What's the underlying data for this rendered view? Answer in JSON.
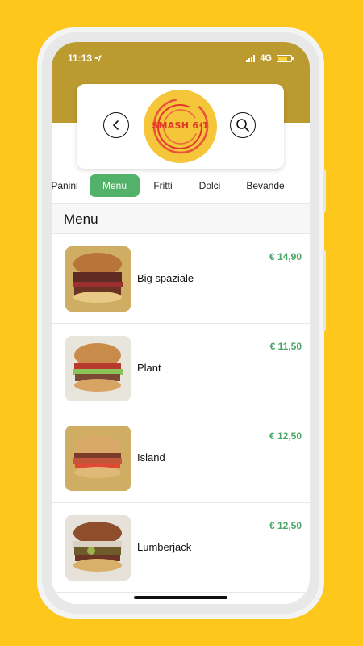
{
  "status_bar": {
    "time": "11:13",
    "network": "4G"
  },
  "header": {
    "logo_text": "SMASH 6·1",
    "back_icon": "chevron-left-icon",
    "search_icon": "search-icon"
  },
  "categories": [
    {
      "label": "Panini",
      "active": false
    },
    {
      "label": "Menu",
      "active": true
    },
    {
      "label": "Fritti",
      "active": false
    },
    {
      "label": "Dolci",
      "active": false
    },
    {
      "label": "Bevande",
      "active": false
    }
  ],
  "section": {
    "title": "Menu"
  },
  "items": [
    {
      "name": "Big spaziale",
      "price": "€ 14,90"
    },
    {
      "name": "Plant",
      "price": "€ 11,50"
    },
    {
      "name": "Island",
      "price": "€ 12,50"
    },
    {
      "name": "Lumberjack",
      "price": "€ 12,50"
    }
  ],
  "colors": {
    "background": "#FDC71B",
    "header_band": "#BB9A2F",
    "accent_green": "#53B26A",
    "price_green": "#4AA566"
  }
}
